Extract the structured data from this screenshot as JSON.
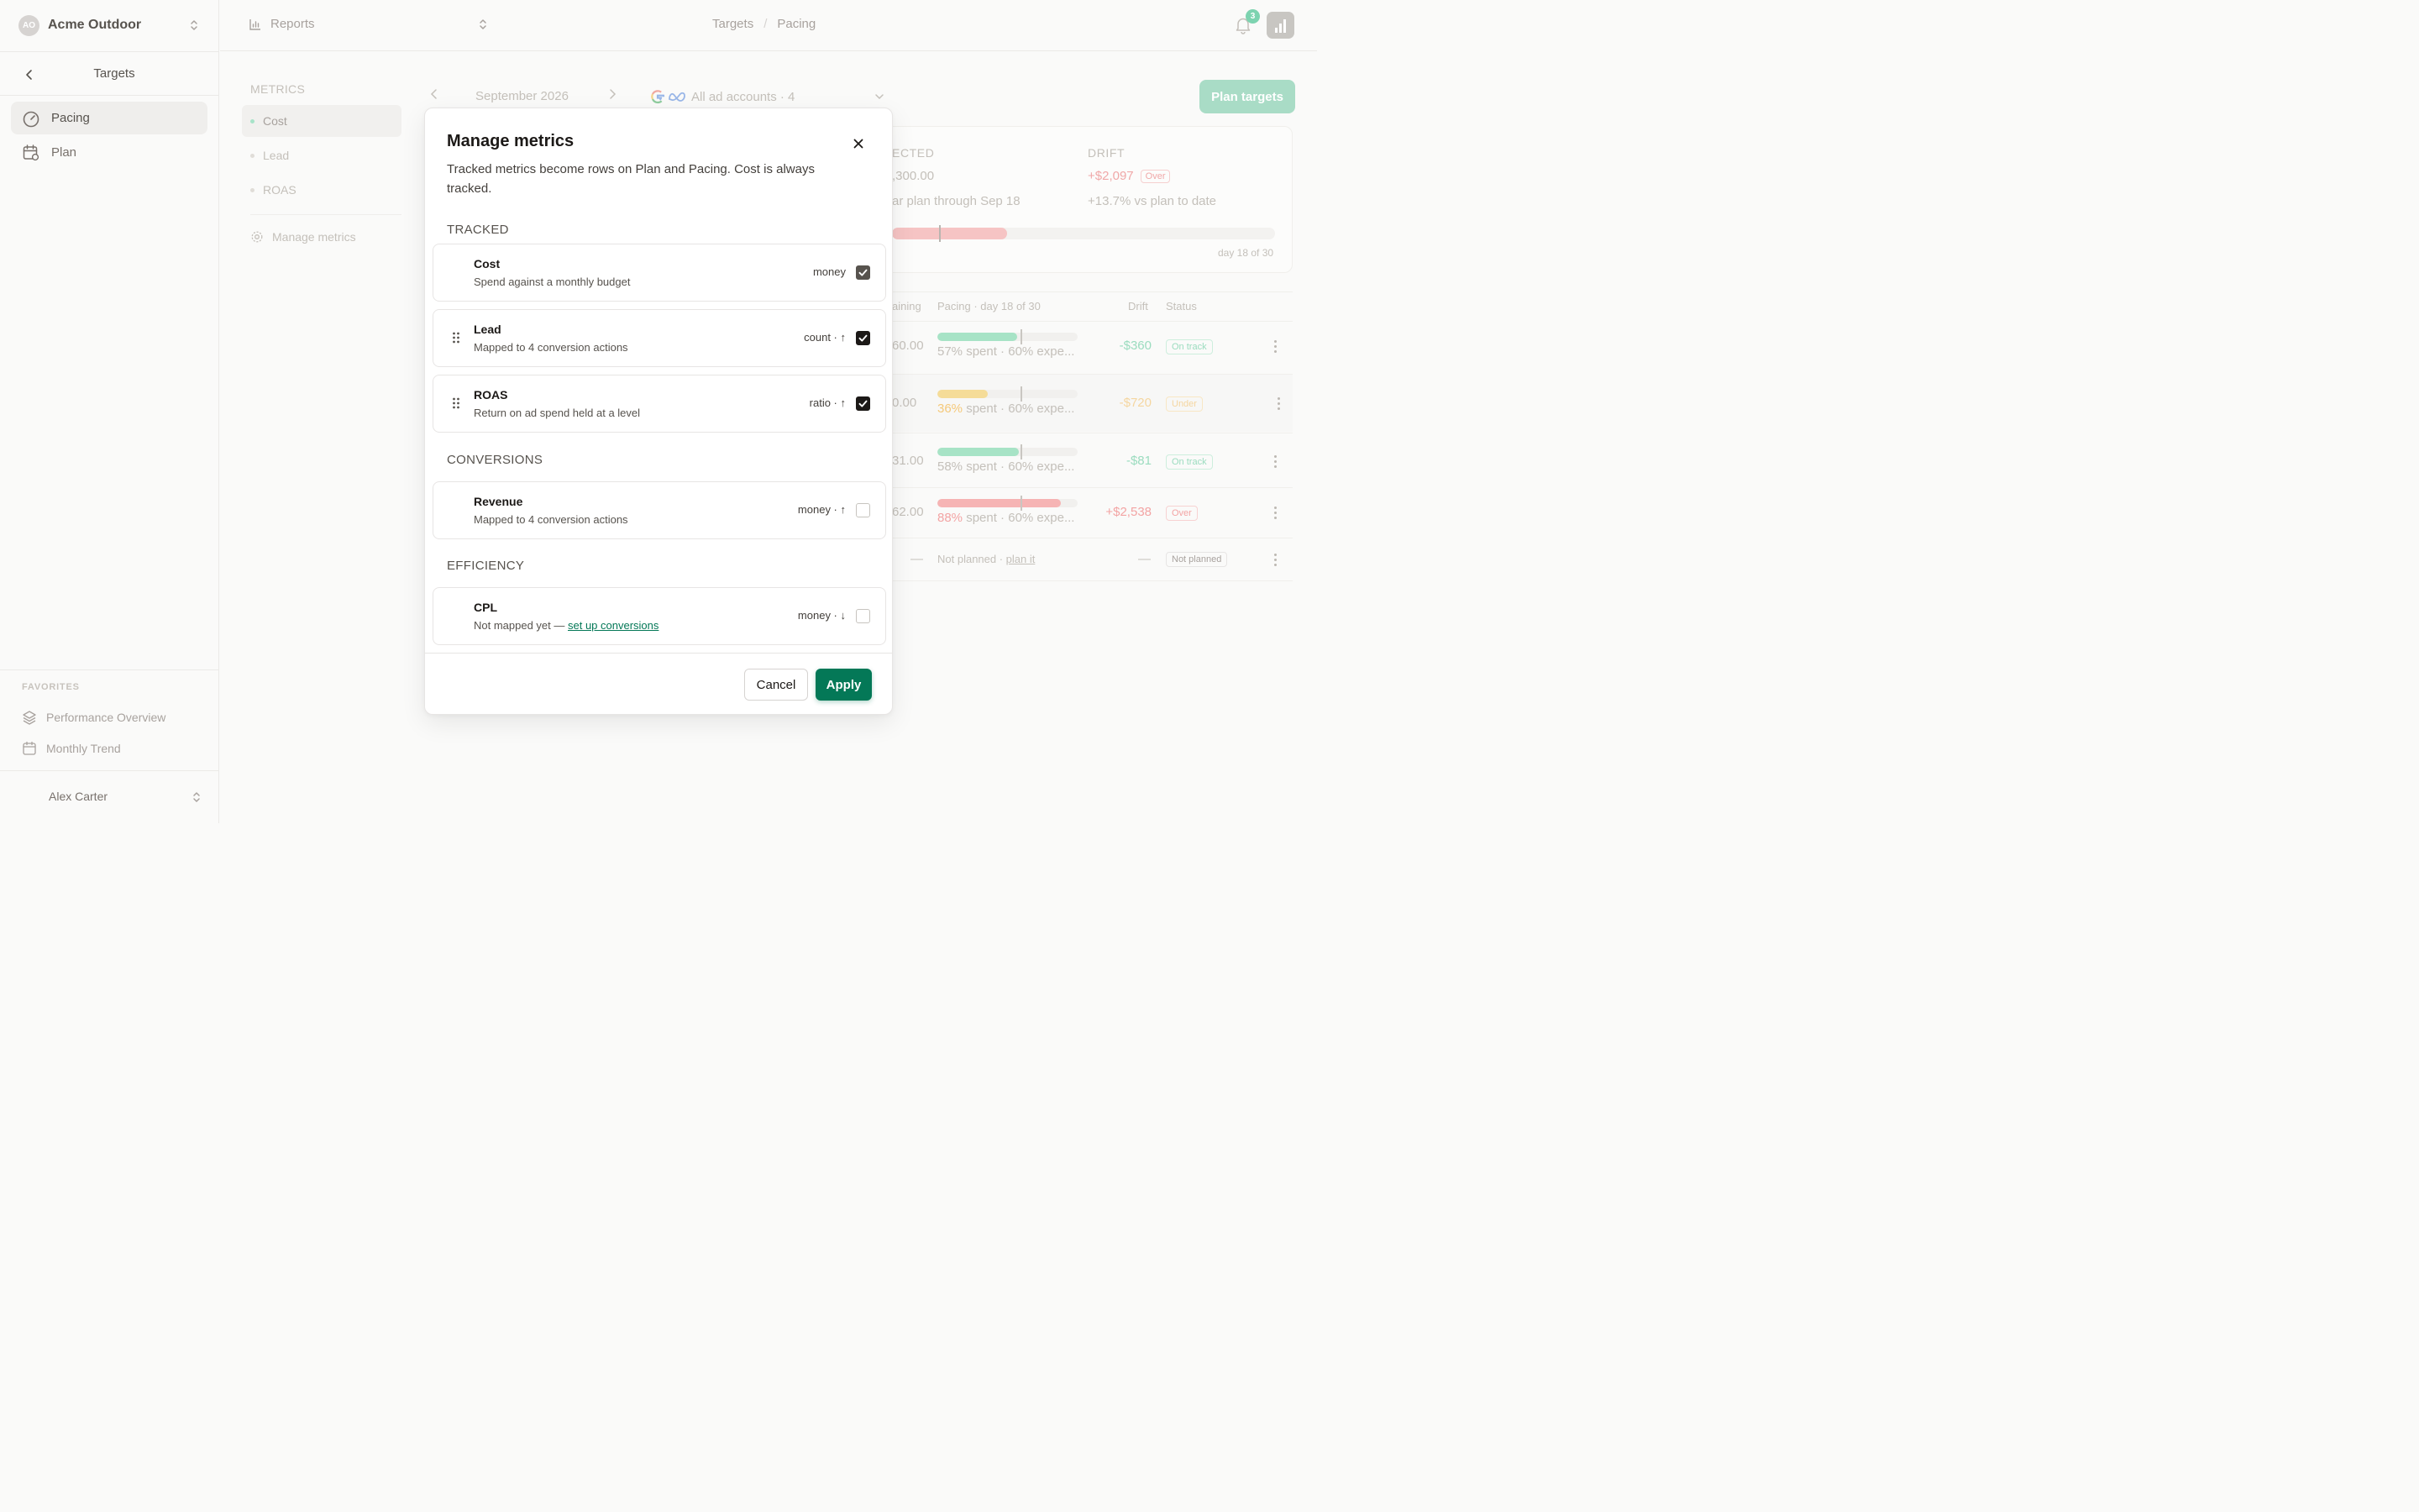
{
  "workspace": {
    "initials": "AO",
    "name": "Acme Outdoor"
  },
  "sidebar": {
    "title": "Targets",
    "items": [
      {
        "label": "Pacing",
        "icon": "gauge-icon",
        "active": true
      },
      {
        "label": "Plan",
        "icon": "calendar-settings-icon",
        "active": false
      }
    ],
    "favorites_heading": "FAVORITES",
    "favorites": [
      {
        "label": "Performance Overview",
        "icon": "layers-icon"
      },
      {
        "label": "Monthly Trend",
        "icon": "calendar-icon"
      }
    ],
    "user": "Alex Carter"
  },
  "topbar": {
    "reports_label": "Reports",
    "breadcrumb": [
      "Targets",
      "/",
      "Pacing"
    ],
    "notifications": "3"
  },
  "background": {
    "metrics_heading": "METRICS",
    "metrics": [
      "Cost",
      "Lead",
      "ROAS"
    ],
    "manage_label": "Manage metrics",
    "month": "September 2026",
    "accounts": "All ad accounts · 4",
    "plan_button": "Plan targets",
    "projected_heading": "ECTED",
    "projected_value": ",300.00",
    "projected_sub": "ar plan through Sep 18",
    "drift_heading": "DRIFT",
    "drift_value": "+$2,097",
    "drift_badge": "Over",
    "drift_sub": "+13.7% vs plan to date",
    "day_label": "day 18 of 30",
    "bar_fill_pct": 30,
    "table_headers": {
      "remaining": "aining",
      "pacing": "Pacing · day 18 of 30",
      "drift": "Drift",
      "status": "Status"
    },
    "rows": [
      {
        "remaining": "60.00",
        "pct": "57%",
        "fill": 57,
        "rest": " spent · 60% expe...",
        "drift": "-$360",
        "status": "On track",
        "tone": "green"
      },
      {
        "remaining": "0.00",
        "pct": "36%",
        "fill": 36,
        "rest": " spent · 60% expe...",
        "drift": "-$720",
        "status": "Under",
        "tone": "amber"
      },
      {
        "remaining": "31.00",
        "pct": "58%",
        "fill": 58,
        "rest": " spent · 60% expe...",
        "drift": "-$81",
        "status": "On track",
        "tone": "green"
      },
      {
        "remaining": "62.00",
        "pct": "88%",
        "fill": 88,
        "rest": " spent · 60% expe...",
        "drift": "+$2,538",
        "status": "Over",
        "tone": "red"
      }
    ],
    "unplanned": {
      "remaining": "—",
      "text": "Not planned · ",
      "link": "plan it",
      "drift": "—",
      "status": "Not planned"
    }
  },
  "modal": {
    "title": "Manage metrics",
    "description": "Tracked metrics become rows on Plan and Pacing. Cost is always tracked.",
    "sections": {
      "tracked": "TRACKED",
      "conversions": "CONVERSIONS",
      "efficiency": "EFFICIENCY"
    },
    "rows": [
      {
        "name": "Cost",
        "desc": "Spend against a monthly budget",
        "meta": "money",
        "checked": true
      },
      {
        "name": "Lead",
        "desc": "Mapped to 4 conversion actions",
        "meta": "count · ↑",
        "checked": true
      },
      {
        "name": "ROAS",
        "desc": "Return on ad spend held at a level",
        "meta": "ratio · ↑",
        "checked": true
      },
      {
        "name": "Revenue",
        "desc": "Mapped to 4 conversion actions",
        "meta": "money · ↑",
        "checked": false
      },
      {
        "name": "CPL",
        "desc": "Not mapped yet — ",
        "link": "set up conversions",
        "meta": "money · ↓",
        "checked": false
      }
    ],
    "cancel_label": "Cancel",
    "apply_label": "Apply"
  },
  "colors": {
    "accent": "#047857",
    "on_track": "#7dd3b0",
    "under": "#f5d98a",
    "over": "#f6a9a9"
  }
}
